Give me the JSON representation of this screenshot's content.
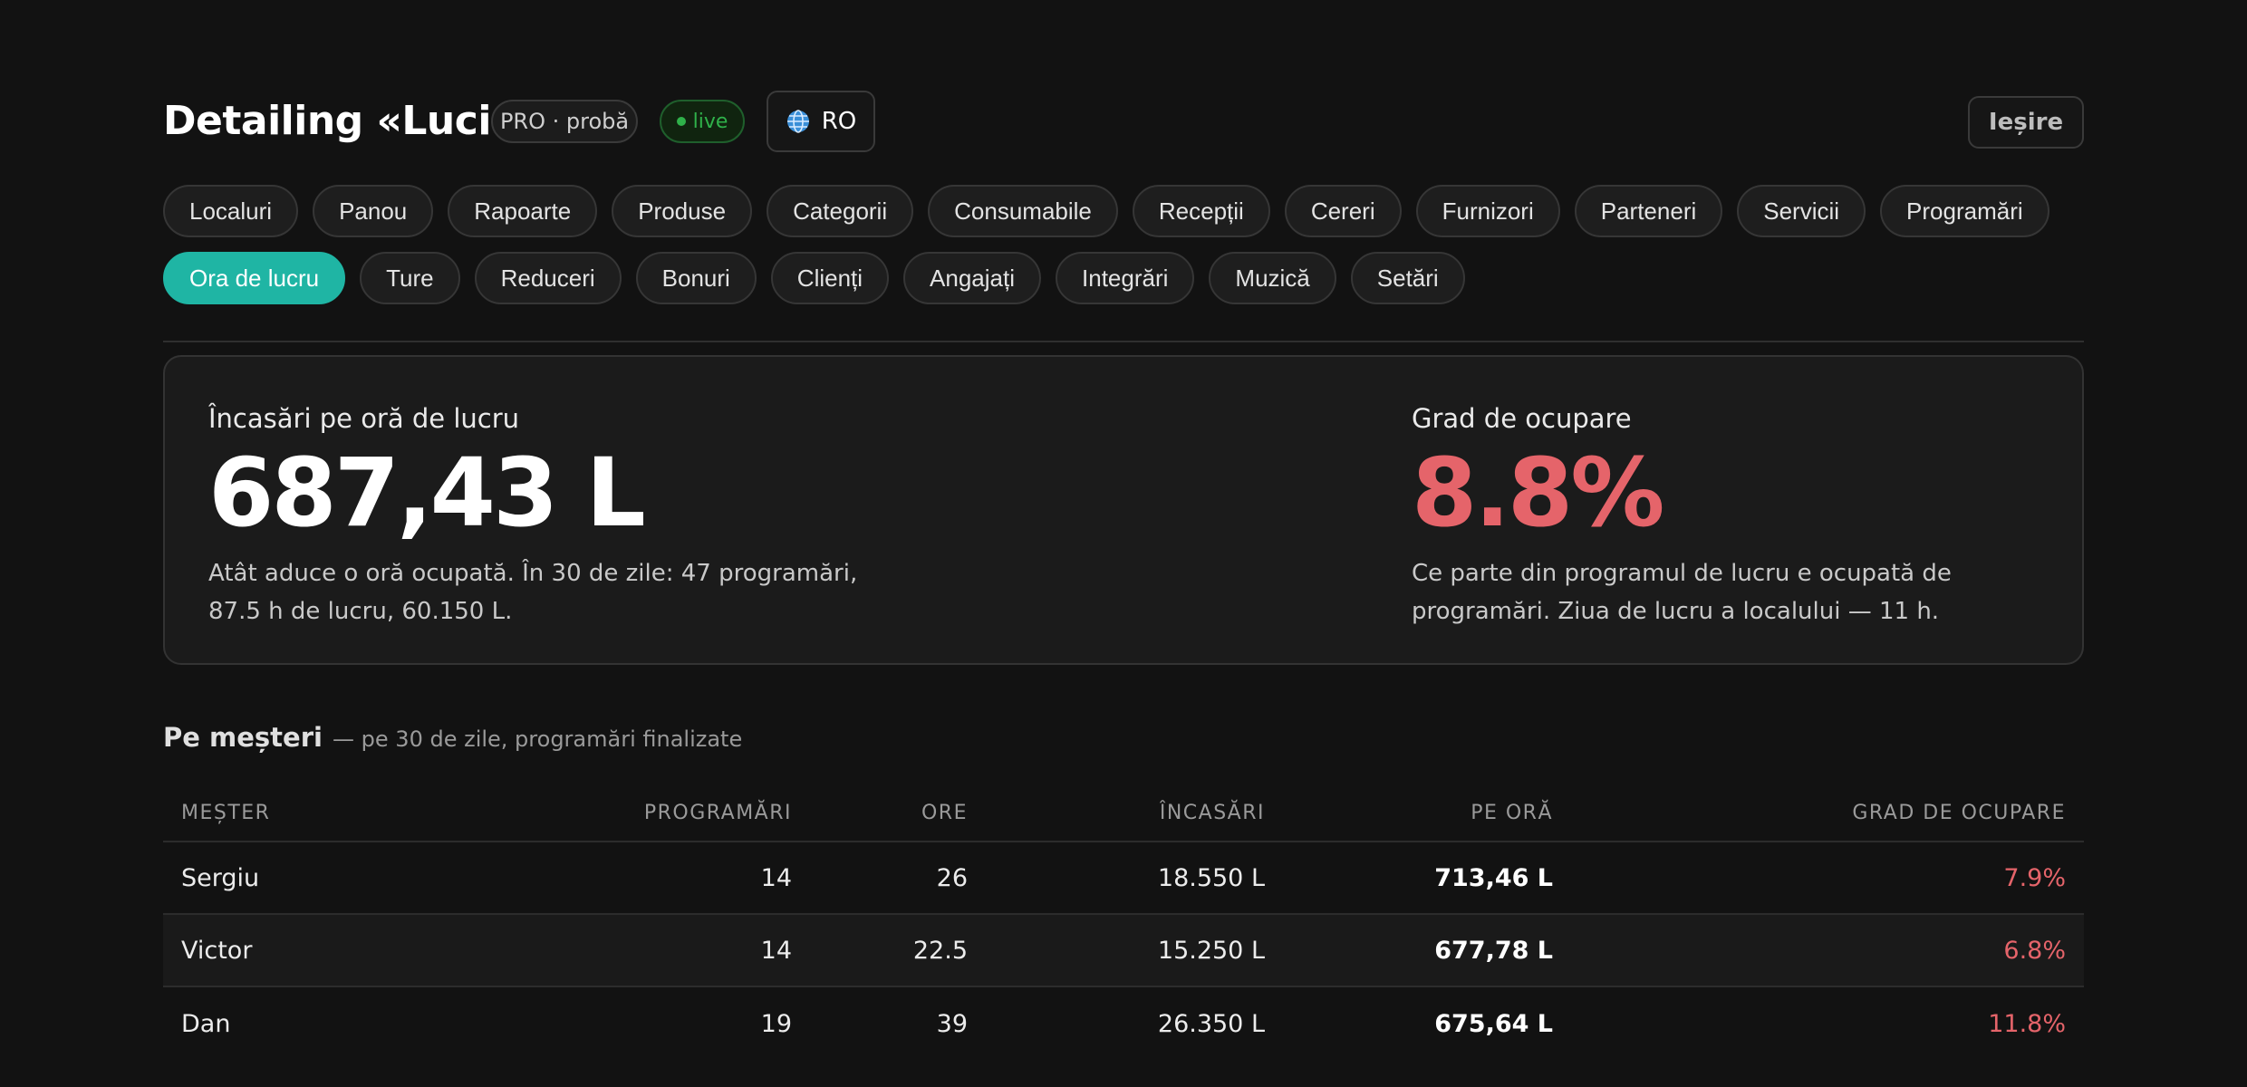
{
  "header": {
    "title": "Detailing «Luciu»",
    "plan_badge": "PRO · probă",
    "live_badge": "live",
    "language": "RO",
    "logout": "Ieșire"
  },
  "nav": {
    "row1": [
      "Localuri",
      "Panou",
      "Rapoarte",
      "Produse",
      "Categorii",
      "Consumabile",
      "Recepții",
      "Cereri",
      "Furnizori",
      "Parteneri",
      "Servicii",
      "Programări"
    ],
    "row2": [
      "Ora de lucru",
      "Ture",
      "Reduceri",
      "Bonuri",
      "Clienți",
      "Angajați",
      "Integrări",
      "Muzică",
      "Setări"
    ],
    "active": "Ora de lucru"
  },
  "metrics": {
    "revenue_per_hour": {
      "label": "Încasări pe oră de lucru",
      "value": "687,43 L",
      "desc_line1": "Atât aduce o oră ocupată. În 30 de zile: 47 programări,",
      "desc_line2": "87.5 h de lucru, 60.150 L."
    },
    "occupancy": {
      "label": "Grad de ocupare",
      "value": "8.8%",
      "desc_line1": "Ce parte din programul de lucru e ocupată de",
      "desc_line2": "programări. Ziua de lucru a localului — 11 h."
    }
  },
  "masters": {
    "title": "Pe meșteri",
    "subtitle": "— pe 30 de zile, programări finalizate",
    "columns": [
      "MEȘTER",
      "PROGRAMĂRI",
      "ORE",
      "ÎNCASĂRI",
      "PE ORĂ",
      "GRAD DE OCUPARE"
    ],
    "rows": [
      {
        "name": "Sergiu",
        "appointments": "14",
        "hours": "26",
        "revenue": "18.550 L",
        "per_hour": "713,46 L",
        "occupancy": "7.9%"
      },
      {
        "name": "Victor",
        "appointments": "14",
        "hours": "22.5",
        "revenue": "15.250 L",
        "per_hour": "677,78 L",
        "occupancy": "6.8%"
      },
      {
        "name": "Dan",
        "appointments": "19",
        "hours": "39",
        "revenue": "26.350 L",
        "per_hour": "675,64 L",
        "occupancy": "11.8%"
      }
    ]
  },
  "colors": {
    "accent": "#1fb5a4",
    "negative": "#e5646a",
    "live": "#2fb14a",
    "background": "#121212"
  },
  "icons": {
    "language": "globe-icon",
    "live": "dot-icon"
  }
}
